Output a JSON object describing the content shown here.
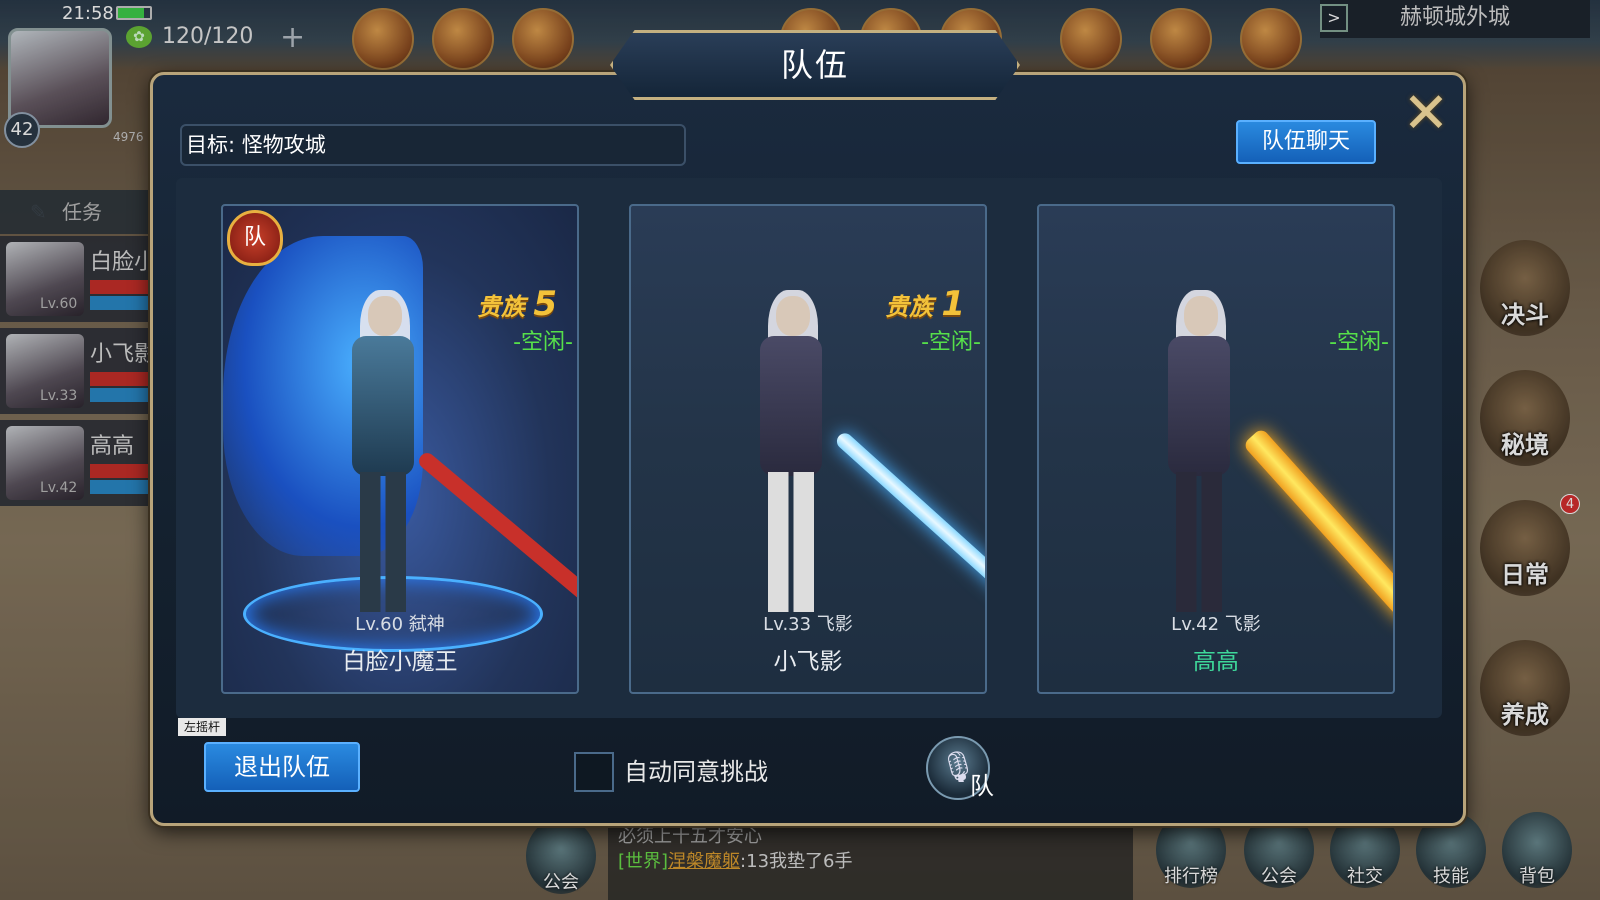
{
  "hud": {
    "time": "21:58",
    "energy": "120/120",
    "level": "42",
    "hp_text": "4976"
  },
  "map_name": "赫顿城外城",
  "left_panel": {
    "task_label": "任务",
    "members": [
      {
        "name": "白脸小",
        "level": "Lv.60"
      },
      {
        "name": "小飞影",
        "level": "Lv.33"
      },
      {
        "name": "高高",
        "level": "Lv.42"
      }
    ]
  },
  "side_buttons": [
    "决斗",
    "秘境",
    "日常",
    "养成"
  ],
  "side_badge": "4",
  "bottom": {
    "chat_line1": "必须上十五才安心",
    "chat_channel": "[世界]",
    "chat_sender": "涅槃魔躯",
    "chat_message": ":13我垫了6手",
    "buttons": [
      "排行榜",
      "公会",
      "社交",
      "技能",
      "背包"
    ],
    "guild_mic_label": "公会"
  },
  "modal": {
    "title": "队伍",
    "target": "目标: 怪物攻城",
    "team_chat_button": "队伍聊天",
    "close_icon": "close-x-icon",
    "leave_button": "退出队伍",
    "joystick_label": "左摇杆",
    "auto_accept_label": "自动同意挑战",
    "voice_label": "队",
    "members": [
      {
        "noble": "贵族",
        "noble_level": "5",
        "status": "-空闲-",
        "level_class": "Lv.60 弑神",
        "name": "白脸小魔王",
        "leader_badge": "队"
      },
      {
        "noble": "贵族",
        "noble_level": "1",
        "status": "-空闲-",
        "level_class": "Lv.33 飞影",
        "name": "小飞影"
      },
      {
        "status": "-空闲-",
        "level_class": "Lv.42 飞影",
        "name": "高高"
      }
    ]
  },
  "colors": {
    "status_green": "#56e04a",
    "button_blue": "#1e74d0",
    "gold_border": "#b8a47a",
    "noble_gold": "#f3c23a"
  }
}
